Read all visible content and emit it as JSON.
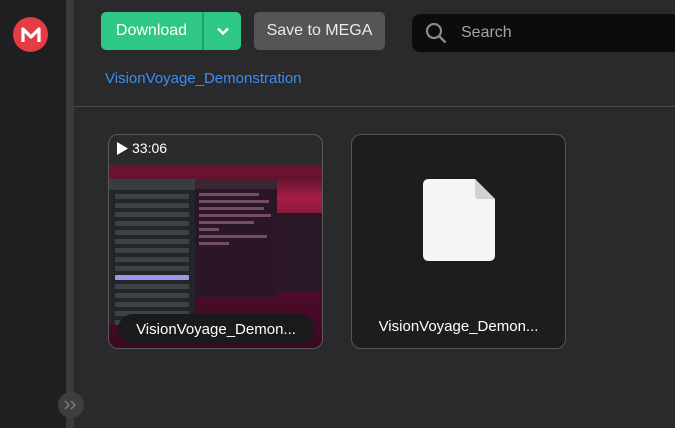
{
  "toolbar": {
    "download_label": "Download",
    "save_label": "Save to MEGA"
  },
  "search": {
    "placeholder": "Search"
  },
  "breadcrumb": {
    "folder": "VisionVoyage_Demonstration"
  },
  "files": [
    {
      "name": "VisionVoyage_Demon...",
      "duration": "33:06",
      "type": "video",
      "thumbnail": true
    },
    {
      "name": "VisionVoyage_Demon...",
      "type": "file",
      "thumbnail": false
    }
  ],
  "colors": {
    "accent_green": "#2ec786",
    "brand_red": "#e43c44",
    "link_blue": "#3a8ef6",
    "background": "#2a2a2c"
  },
  "icons": [
    "mega-logo-icon",
    "chevron-down-icon",
    "search-icon",
    "play-icon",
    "file-icon",
    "expand-sidebar-icon"
  ]
}
